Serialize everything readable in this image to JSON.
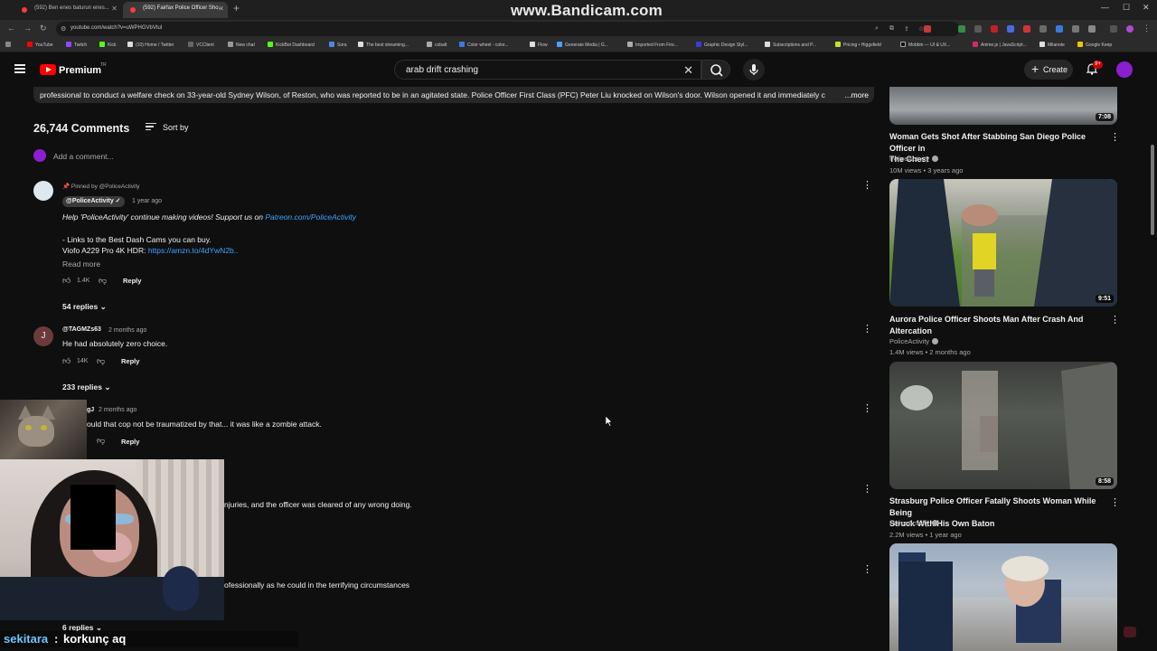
{
  "browser": {
    "tabs": [
      {
        "title": "(592) Ben enes baturun enes..."
      },
      {
        "title": "(592) Fairfax Police Officer Sho..."
      }
    ],
    "url": "youtube.com/watch?v=uWPHGVbVtuI",
    "bookmarks": [
      "YouTube",
      "Twitch",
      "Kick",
      "(10) Home / Twitter",
      "VCClient",
      "New chat",
      "KickBot Dashboard",
      "Sora",
      "The best streaming...",
      "cobalt",
      "Color wheel - color...",
      "Flow",
      "Generate Media | G...",
      "Imported From Fire...",
      "Graphic Design Styl...",
      "Subscriptions and P...",
      "Pricing • Higgsfield",
      "Mobbin — UI & UX...",
      "Anime.js | JavaScript...",
      "Milanote",
      "Google Keep"
    ],
    "watermark": "www.Bandicam.com"
  },
  "header": {
    "brand": "Premium",
    "country": "TR",
    "search_value": "arab drift crashing",
    "create_label": "Create",
    "notif_count": "9+"
  },
  "description": {
    "text": "professional to conduct a welfare check on 33-year-old Sydney Wilson, of Reston, who was reported to be in an agitated state. Police Officer First Class (PFC) Peter Liu knocked on Wilson's door. Wilson opened it and immediately c",
    "more": "...more"
  },
  "comments": {
    "count": "26,744 Comments",
    "sort_label": "Sort by",
    "add_placeholder": "Add a comment...",
    "items": [
      {
        "pinned": "Pinned by @PoliceActivity",
        "author": "@PoliceActivity",
        "time": "1 year ago",
        "line1_prefix": "Help 'PoliceActivity' continue making videos! Support us on ",
        "line1_link": "Patreon.com/PoliceActivity",
        "line2": "- Links to the Best Dash Cams you can buy.",
        "line3_prefix": "Viofo A229 Pro 4K HDR: ",
        "line3_link": "https://amzn.to/4dYwN2b..",
        "read_more": "Read more",
        "likes": "1.4K",
        "reply": "Reply",
        "replies": "54 replies"
      },
      {
        "avatar_letter": "J",
        "author": "@TAGMZs63",
        "time": "2 months ago",
        "text": "He had absolutely zero choice.",
        "likes": "14K",
        "reply": "Reply",
        "replies": "233 replies"
      },
      {
        "author": "gJ",
        "time": "2 months ago",
        "text": "ould that cop not be traumatized by that... it was like a zombie attack.",
        "reply": "Reply"
      },
      {
        "text": "njuries, and the officer was cleared of any wrong doing."
      },
      {
        "text": "ofessionally as he could in the terrifying circumstances",
        "replies": "6 replies"
      }
    ]
  },
  "chat": {
    "user": "sekitara",
    "separator": ":",
    "message": "korkunç aq"
  },
  "sidebar": {
    "videos": [
      {
        "title_lines": [
          "Woman Gets Shot After Stabbing San Diego Police Officer in",
          "The Chest"
        ],
        "channel": "PoliceActivity",
        "meta": "10M views • 3 years ago",
        "duration": "7:08"
      },
      {
        "title_lines": [
          "Aurora Police Officer Shoots Man After Crash And",
          "Altercation"
        ],
        "channel": "PoliceActivity",
        "meta": "1.4M views • 2 months ago",
        "duration": "9:51"
      },
      {
        "title_lines": [
          "Strasburg Police Officer Fatally Shoots Woman While Being",
          "Struck With His Own Baton"
        ],
        "channel": "PoliceActivity",
        "meta": "2.2M views • 1 year ago",
        "duration": "8:58"
      }
    ]
  }
}
